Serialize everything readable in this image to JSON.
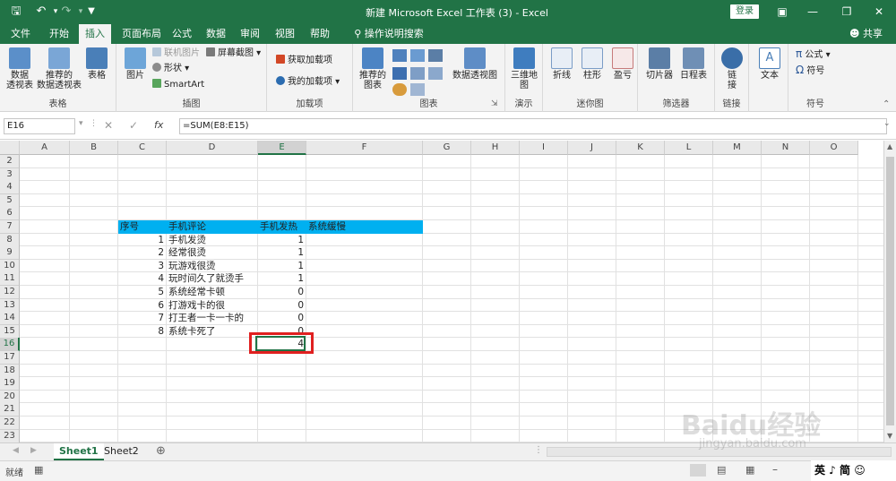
{
  "window": {
    "title": "新建 Microsoft Excel 工作表 (3)  -  Excel",
    "login_label": "登录",
    "share_label": "共享"
  },
  "tabs": [
    {
      "label": "文件"
    },
    {
      "label": "开始"
    },
    {
      "label": "插入"
    },
    {
      "label": "页面布局"
    },
    {
      "label": "公式"
    },
    {
      "label": "数据"
    },
    {
      "label": "审阅"
    },
    {
      "label": "视图"
    },
    {
      "label": "帮助"
    },
    {
      "label": "操作说明搜索"
    }
  ],
  "ribbon": {
    "tables": {
      "group": "表格",
      "pivot": "数据\n透视表",
      "recommended_pivot": "推荐的\n数据透视表",
      "table": "表格"
    },
    "illustrations": {
      "group": "插图",
      "pictures": "图片",
      "online_pictures": "联机图片",
      "shapes": "形状",
      "smartart": "SmartArt",
      "screenshot": "屏幕截图"
    },
    "addins": {
      "group": "加载项",
      "get_addins": "获取加载项",
      "my_addins": "我的加载项"
    },
    "charts": {
      "group": "图表",
      "recommended": "推荐的\n图表",
      "pivotchart": "数据透视图"
    },
    "tours": {
      "group": "演示",
      "map3d": "三维地\n图"
    },
    "sparklines": {
      "group": "迷你图",
      "line": "折线",
      "column": "柱形",
      "winloss": "盈亏"
    },
    "filters": {
      "group": "筛选器",
      "slicer": "切片器",
      "timeline": "日程表"
    },
    "links": {
      "group": "链接",
      "link": "链\n接"
    },
    "text": {
      "group": "",
      "text": "文本"
    },
    "symbols": {
      "group": "符号",
      "equation": "公式",
      "symbol": "符号"
    }
  },
  "formula_bar": {
    "name_box": "E16",
    "fx": "fx",
    "formula": "=SUM(E8:E15)"
  },
  "columns": [
    "A",
    "B",
    "C",
    "D",
    "E",
    "F",
    "G",
    "H",
    "I",
    "J",
    "K",
    "L",
    "M",
    "N",
    "O"
  ],
  "rows": [
    "2",
    "3",
    "4",
    "5",
    "6",
    "7",
    "8",
    "9",
    "10",
    "11",
    "12",
    "13",
    "14",
    "15",
    "16",
    "17",
    "18",
    "19",
    "20",
    "21",
    "22",
    "23"
  ],
  "table": {
    "header": {
      "c": "序号",
      "d": "手机评论",
      "e": "手机发热",
      "f": "系统缓慢"
    },
    "rows": [
      {
        "c": "1",
        "d": "手机发烫",
        "e": "1"
      },
      {
        "c": "2",
        "d": "经常很烫",
        "e": "1"
      },
      {
        "c": "3",
        "d": "玩游戏很烫",
        "e": "1"
      },
      {
        "c": "4",
        "d": "玩时间久了就烫手",
        "e": "1"
      },
      {
        "c": "5",
        "d": "系统经常卡顿",
        "e": "0"
      },
      {
        "c": "6",
        "d": "打游戏卡的很",
        "e": "0"
      },
      {
        "c": "7",
        "d": "打王者一卡一卡的",
        "e": "0"
      },
      {
        "c": "8",
        "d": "系统卡死了",
        "e": "0"
      }
    ],
    "sum": "4"
  },
  "sheets": [
    {
      "label": "Sheet1"
    },
    {
      "label": "Sheet2"
    }
  ],
  "status": {
    "ready": "就绪"
  },
  "watermark": {
    "text": "Baidu经验",
    "url": "jingyan.baidu.com"
  },
  "ime": {
    "text": "英 ♪ 简 ☺"
  }
}
